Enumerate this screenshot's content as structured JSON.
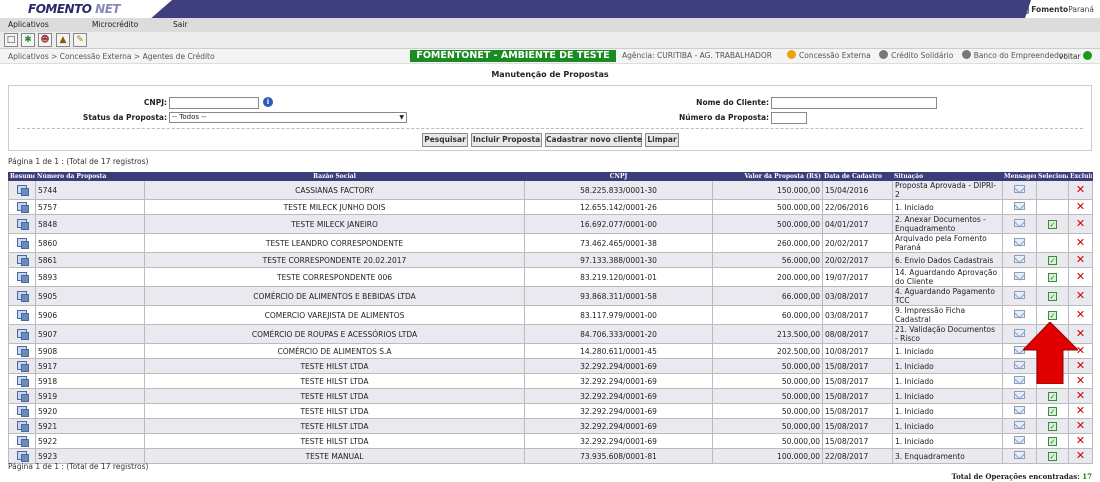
{
  "brand": {
    "logo_main": "FOMENTO",
    "logo_sub": "NET",
    "partner": "Fomento",
    "partner_bold": "Paraná"
  },
  "menu": [
    "Aplicativos",
    "Microcrédito",
    "Sair"
  ],
  "toolbar": [
    "new-doc-icon",
    "add-icon",
    "people-icon",
    "triangle-icon",
    "edit-icon"
  ],
  "breadcrumb": "Aplicativos > Concessão Externa > Agentes de Crédito",
  "environment": "FOMENTONET - AMBIENTE DE TESTE",
  "agencia": "Agência: CURITIBA - AG. TRABALHADOR",
  "links": [
    "Concessão Externa",
    "Crédito Solidário",
    "Banco do Empreendedor"
  ],
  "voltar": "voltar",
  "page_title": "Manutenção de Propostas",
  "filter": {
    "cnpj_label": "CNPJ:",
    "cnpj_value": "",
    "status_label": "Status da Proposta:",
    "status_value": "-- Todos --",
    "nome_label": "Nome do Cliente:",
    "nome_value": "",
    "numero_label": "Número da Proposta:",
    "numero_value": ""
  },
  "buttons": {
    "pesquisar": "Pesquisar",
    "incluir": "Incluir Proposta",
    "cadastrar": "Cadastrar novo cliente",
    "limpar": "Limpar"
  },
  "pagination_top": "Página 1 de 1 : (Total de 17 registros)",
  "pagination_bottom": "Página 1 de 1 : (Total de 17 registros)",
  "table": {
    "headers": [
      "Resumo",
      "Número da Proposta",
      "Razão Social",
      "CNPJ",
      "Valor da Proposta (R$)",
      "Data de Cadastro",
      "Situação",
      "Mensagens",
      "Selecionar",
      "Excluir"
    ],
    "rows": [
      {
        "numero": "5744",
        "razao": "CASSIANAS FACTORY",
        "cnpj": "58.225.833/0001-30",
        "valor": "150.000,00",
        "data": "15/04/2016",
        "situacao": "Proposta Aprovada - DIPRI-2",
        "sel": false
      },
      {
        "numero": "5757",
        "razao": "TESTE MILECK JUNHO DOIS",
        "cnpj": "12.655.142/0001-26",
        "valor": "500.000,00",
        "data": "22/06/2016",
        "situacao": "1. Iniciado",
        "sel": false
      },
      {
        "numero": "5848",
        "razao": "TESTE MILECK JANEIRO",
        "cnpj": "16.692.077/0001-00",
        "valor": "500.000,00",
        "data": "04/01/2017",
        "situacao": "2. Anexar Documentos - Enquadramento",
        "sel": true
      },
      {
        "numero": "5860",
        "razao": "TESTE LEANDRO CORRESPONDENTE",
        "cnpj": "73.462.465/0001-38",
        "valor": "260.000,00",
        "data": "20/02/2017",
        "situacao": "Arquivado pela Fomento Paraná",
        "sel": false
      },
      {
        "numero": "5861",
        "razao": "TESTE CORRESPONDENTE 20.02.2017",
        "cnpj": "97.133.388/0001-30",
        "valor": "56.000,00",
        "data": "20/02/2017",
        "situacao": "6. Envio Dados Cadastrais",
        "sel": true
      },
      {
        "numero": "5893",
        "razao": "TESTE CORRESPONDENTE 006",
        "cnpj": "83.219.120/0001-01",
        "valor": "200.000,00",
        "data": "19/07/2017",
        "situacao": "14. Aguardando Aprovação do Cliente",
        "sel": true
      },
      {
        "numero": "5905",
        "razao": "COMÉRCIO DE ALIMENTOS E BEBIDAS LTDA",
        "cnpj": "93.868.311/0001-58",
        "valor": "66.000,00",
        "data": "03/08/2017",
        "situacao": "4. Aguardando Pagamento TCC",
        "sel": true
      },
      {
        "numero": "5906",
        "razao": "COMERCIO VAREJISTA DE ALIMENTOS",
        "cnpj": "83.117.979/0001-00",
        "valor": "60.000,00",
        "data": "03/08/2017",
        "situacao": "9. Impressão Ficha Cadastral",
        "sel": true
      },
      {
        "numero": "5907",
        "razao": "COMÉRCIO DE ROUPAS E ACESSÓRIOS LTDA",
        "cnpj": "84.706.333/0001-20",
        "valor": "213.500,00",
        "data": "08/08/2017",
        "situacao": "21. Validação Documentos - Risco",
        "sel": true
      },
      {
        "numero": "5908",
        "razao": "COMÉRCIO DE ALIMENTOS S.A",
        "cnpj": "14.280.611/0001-45",
        "valor": "202.500,00",
        "data": "10/08/2017",
        "situacao": "1. Iniciado",
        "sel": false
      },
      {
        "numero": "5917",
        "razao": "TESTE HILST LTDA",
        "cnpj": "32.292.294/0001-69",
        "valor": "50.000,00",
        "data": "15/08/2017",
        "situacao": "1. Iniciado",
        "sel": false
      },
      {
        "numero": "5918",
        "razao": "TESTE HILST LTDA",
        "cnpj": "32.292.294/0001-69",
        "valor": "50.000,00",
        "data": "15/08/2017",
        "situacao": "1. Iniciado",
        "sel": false
      },
      {
        "numero": "5919",
        "razao": "TESTE HILST LTDA",
        "cnpj": "32.292.294/0001-69",
        "valor": "50.000,00",
        "data": "15/08/2017",
        "situacao": "1. Iniciado",
        "sel": true
      },
      {
        "numero": "5920",
        "razao": "TESTE HILST LTDA",
        "cnpj": "32.292.294/0001-69",
        "valor": "50.000,00",
        "data": "15/08/2017",
        "situacao": "1. Iniciado",
        "sel": true
      },
      {
        "numero": "5921",
        "razao": "TESTE HILST LTDA",
        "cnpj": "32.292.294/0001-69",
        "valor": "50.000,00",
        "data": "15/08/2017",
        "situacao": "1. Iniciado",
        "sel": true
      },
      {
        "numero": "5922",
        "razao": "TESTE HILST LTDA",
        "cnpj": "32.292.294/0001-69",
        "valor": "50.000,00",
        "data": "15/08/2017",
        "situacao": "1. Iniciado",
        "sel": true
      },
      {
        "numero": "5923",
        "razao": "TESTE MANUAL",
        "cnpj": "73.935.608/0001-81",
        "valor": "100.000,00",
        "data": "22/08/2017",
        "situacao": "3. Enquadramento",
        "sel": true
      }
    ]
  },
  "total_label": "Total de Operações encontradas:",
  "total_value": "17",
  "colors": {
    "header": "#3c3c7a",
    "env": "#1a8a22",
    "arrow": "#e00000"
  }
}
